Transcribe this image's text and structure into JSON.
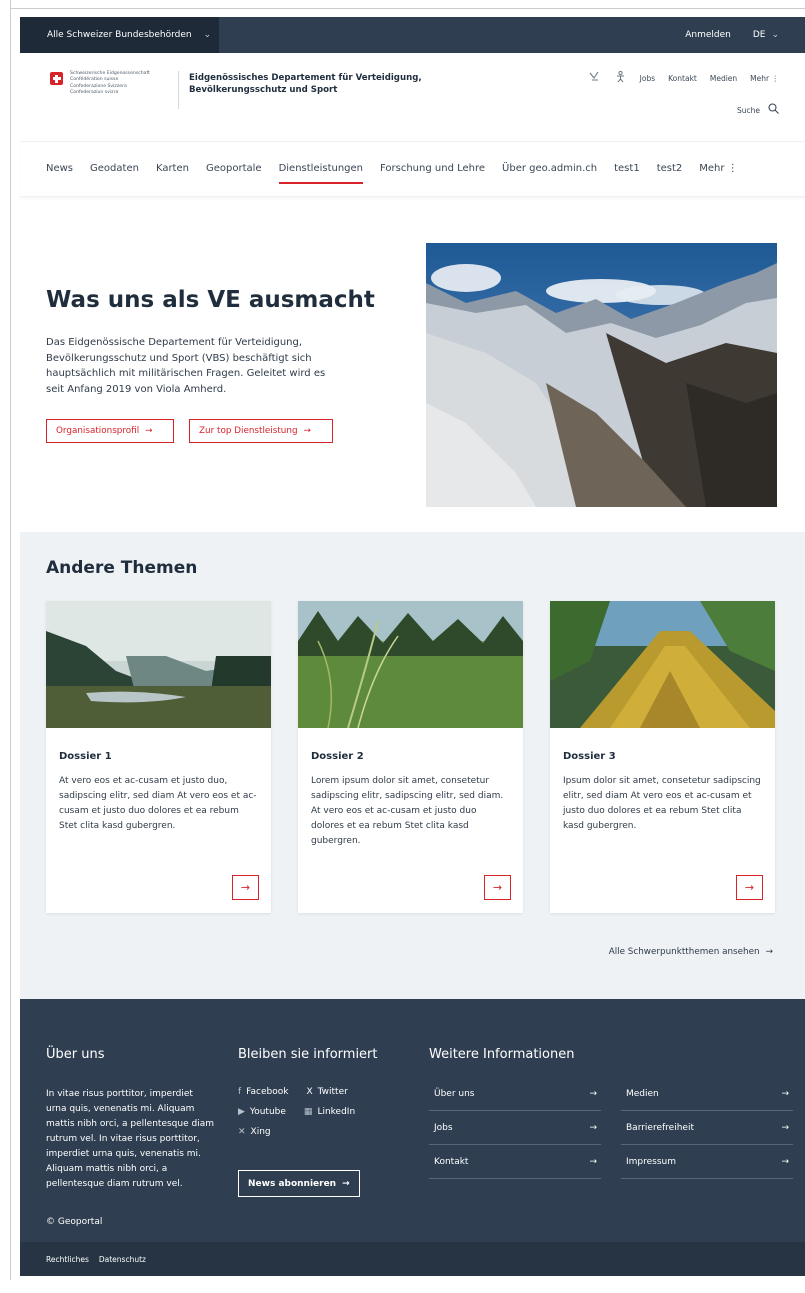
{
  "topbar": {
    "departments_label": "Alle Schweizer Bundesbehörden",
    "login": "Anmelden",
    "language": "DE"
  },
  "header": {
    "logo_lines": [
      "Schweizerische Eidgenossenschaft",
      "Confédération suisse",
      "Confederazione Svizzera",
      "Confederaziun svizra"
    ],
    "department": "Eidgenössisches Departement für Verteidigung, Bevölkerungsschutz und Sport",
    "meta_links": [
      "Jobs",
      "Kontakt",
      "Medien",
      "Mehr"
    ],
    "search_label": "Suche"
  },
  "mainnav": {
    "items": [
      "News",
      "Geodaten",
      "Karten",
      "Geoportale",
      "Dienstleistungen",
      "Forschung und Lehre",
      "Über geo.admin.ch",
      "test1",
      "test2",
      "Mehr"
    ],
    "active": "Dienstleistungen"
  },
  "hero": {
    "title": "Was uns als VE ausmacht",
    "text": "Das Eidgenössische Departement für Verteidigung, Bevölkerungsschutz und Sport (VBS) beschäftigt sich hauptsächlich mit militärischen Fragen. Geleitet wird es seit Anfang 2019 von Viola Amherd.",
    "button1": "Organisationsprofil",
    "button2": "Zur top Dienstleistung"
  },
  "topics": {
    "heading": "Andere Themen",
    "cards": [
      {
        "title": "Dossier 1",
        "text": "At vero eos et ac-cusam et justo duo, sadipscing elitr, sed diam At vero eos et ac-cusam et justo duo dolores et ea rebum Stet clita kasd gubergren."
      },
      {
        "title": "Dossier 2",
        "text": "Lorem ipsum dolor sit amet, consetetur sadipscing elitr, sadipscing elitr, sed diam. At vero eos et ac-cusam et justo duo dolores et ea rebum Stet clita kasd gubergren."
      },
      {
        "title": "Dossier 3",
        "text": "Ipsum dolor sit amet, consetetur sadipscing elitr, sed diam At vero eos et ac-cusam et justo duo dolores et ea rebum Stet clita kasd gubergren."
      }
    ],
    "all_link": "Alle Schwerpunktthemen ansehen"
  },
  "footer": {
    "about_heading": "Über uns",
    "about_text": "In vitae risus porttitor, imperdiet urna quis, venenatis mi. Aliquam mattis nibh orci, a pellentesque diam rutrum vel. In vitae risus porttitor, imperdiet urna quis, venenatis mi. Aliquam mattis nibh orci, a pellentesque diam rutrum vel.",
    "copyright": "© Geoportal",
    "stay_heading": "Bleiben sie informiert",
    "social": [
      "Facebook",
      "Twitter",
      "Youtube",
      "LinkedIn",
      "Xing"
    ],
    "newsletter": "News abonnieren",
    "more_heading": "Weitere Informationen",
    "links_a": [
      "Über uns",
      "Jobs",
      "Kontakt"
    ],
    "links_b": [
      "Medien",
      "Barrierefreiheit",
      "Impressum"
    ],
    "bottom_links": [
      "Rechtliches",
      "Datenschutz"
    ]
  },
  "colors": {
    "accent_red": "#d8232a",
    "dark_blue": "#2f3f51",
    "light_bg": "#eef2f5"
  }
}
